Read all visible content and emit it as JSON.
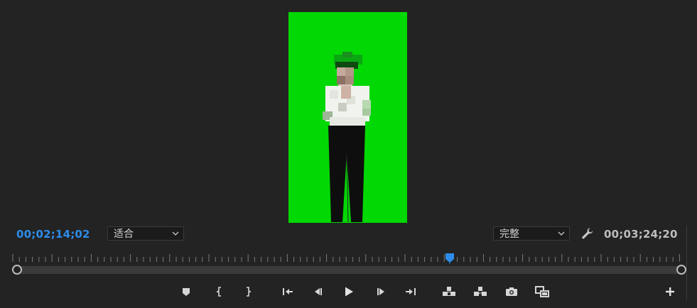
{
  "monitor": {
    "current_timecode": "00;02;14;02",
    "duration_timecode": "00;03;24;20",
    "zoom_select": {
      "value": "适合"
    },
    "quality_select": {
      "value": "完整"
    },
    "playhead_fraction": 0.65,
    "accent_color": "#2d8ceb",
    "video_background_color": "#02d804"
  },
  "icons": {
    "settings": "wrench-icon",
    "add_button": "plus-icon"
  },
  "transport_buttons": [
    "add-marker",
    "mark-in",
    "mark-out",
    "go-to-in",
    "step-back",
    "play",
    "step-forward",
    "go-to-out",
    "lift",
    "extract",
    "export-frame",
    "compare-view",
    "button-editor"
  ]
}
